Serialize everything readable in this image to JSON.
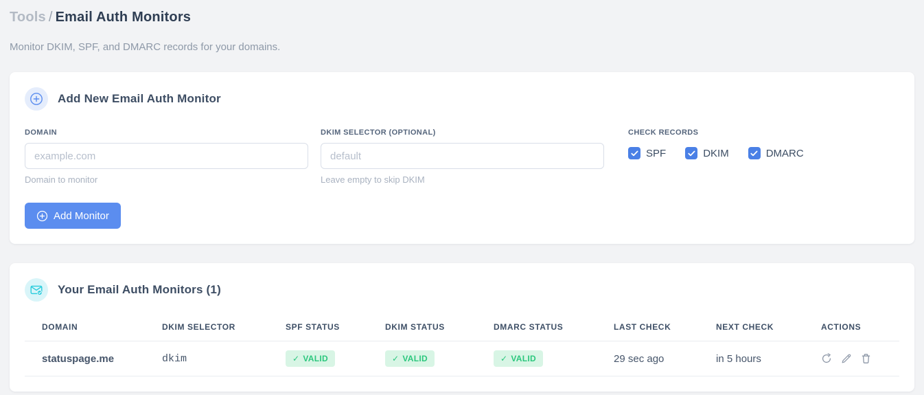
{
  "colors": {
    "accent_blue": "#5b8def",
    "checkbox_blue": "#4a80e6",
    "badge_blue_bg": "#e5edfc",
    "cyan": "#27cbdc",
    "badge_cyan_bg": "#d9f5f9",
    "valid_green": "#2bc77d",
    "valid_green_bg": "#d8f5e5",
    "selector_pink": "#ed4f82",
    "page_bg": "#f2f3f5",
    "card_bg": "#ffffff"
  },
  "icons": {
    "check": "✓"
  },
  "breadcrumb": {
    "section": "Tools",
    "separator": "/",
    "page": "Email Auth Monitors"
  },
  "subtitle": "Monitor DKIM, SPF, and DMARC records for your domains.",
  "add_card": {
    "title": "Add New Email Auth Monitor",
    "fields": {
      "domain": {
        "label": "DOMAIN",
        "placeholder": "example.com",
        "helper": "Domain to monitor"
      },
      "dkim_selector": {
        "label": "DKIM SELECTOR (OPTIONAL)",
        "placeholder": "default",
        "helper": "Leave empty to skip DKIM"
      }
    },
    "check_records": {
      "label": "CHECK RECORDS",
      "options": [
        {
          "label": "SPF",
          "checked": true
        },
        {
          "label": "DKIM",
          "checked": true
        },
        {
          "label": "DMARC",
          "checked": true
        }
      ]
    },
    "submit_label": "Add Monitor"
  },
  "monitors_card": {
    "title": "Your Email Auth Monitors (1)",
    "columns": [
      "DOMAIN",
      "DKIM SELECTOR",
      "SPF STATUS",
      "DKIM STATUS",
      "DMARC STATUS",
      "LAST CHECK",
      "NEXT CHECK",
      "ACTIONS"
    ],
    "rows": [
      {
        "domain": "statuspage.me",
        "dkim_selector": "dkim",
        "spf_status": "VALID",
        "dkim_status": "VALID",
        "dmarc_status": "VALID",
        "last_check": "29 sec ago",
        "next_check": "in 5 hours"
      }
    ]
  }
}
